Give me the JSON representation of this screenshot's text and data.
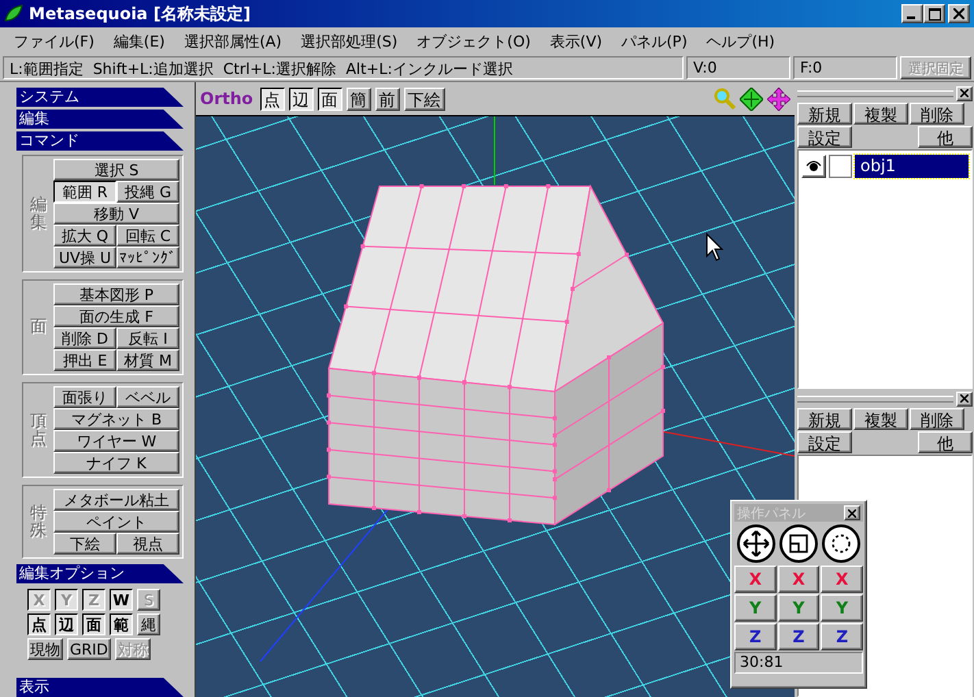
{
  "window": {
    "title": "Metasequoia [名称未設定]"
  },
  "menu": [
    "ファイル(F)",
    "編集(E)",
    "選択部属性(A)",
    "選択部処理(S)",
    "オブジェクト(O)",
    "表示(V)",
    "パネル(P)",
    "ヘルプ(H)"
  ],
  "hint_bar": {
    "hint": "L:範囲指定  Shift+L:追加選択  Ctrl+L:選択解除  Alt+L:インクルード選択",
    "vertices": "V:0",
    "faces": "F:0",
    "lock_button": {
      "label": "選択固定",
      "disabled": true
    }
  },
  "left_panel": {
    "top_headers": [
      "システム",
      "編集"
    ],
    "command_header": "コマンド",
    "command_groups": [
      {
        "label": "編集",
        "rows": [
          [
            {
              "label": "選択 S",
              "selected": false
            }
          ],
          [
            {
              "label": "範囲 R",
              "selected": true
            },
            {
              "label": "投縄 G",
              "selected": false
            }
          ],
          [
            {
              "label": "移動 V",
              "selected": false
            }
          ],
          [
            {
              "label": "拡大 Q",
              "selected": false
            },
            {
              "label": "回転 C",
              "selected": false
            }
          ],
          [
            {
              "label": "UV操 U",
              "selected": false
            },
            {
              "label": "ﾏｯﾋﾟﾝｸﾞ",
              "selected": false
            }
          ]
        ]
      },
      {
        "label": "面",
        "rows": [
          [
            {
              "label": "基本図形 P",
              "selected": false
            }
          ],
          [
            {
              "label": "面の生成 F",
              "selected": false
            }
          ],
          [
            {
              "label": "削除 D",
              "selected": false
            },
            {
              "label": "反転 I",
              "selected": false
            }
          ],
          [
            {
              "label": "押出 E",
              "selected": false
            },
            {
              "label": "材質 M",
              "selected": false
            }
          ]
        ]
      },
      {
        "label": "頂点",
        "rows": [
          [
            {
              "label": "面張り",
              "selected": false
            },
            {
              "label": "ベベル",
              "selected": false
            }
          ],
          [
            {
              "label": "マグネット B",
              "selected": false
            }
          ],
          [
            {
              "label": "ワイヤー W",
              "selected": false
            }
          ],
          [
            {
              "label": "ナイフ K",
              "selected": false
            }
          ]
        ]
      },
      {
        "label": "特殊",
        "rows": [
          [
            {
              "label": "メタボール粘土",
              "selected": false
            }
          ],
          [
            {
              "label": "ペイント",
              "selected": false
            }
          ],
          [
            {
              "label": "下絵",
              "selected": false
            },
            {
              "label": "視点",
              "selected": false
            }
          ]
        ]
      }
    ],
    "options_header": "編集オプション",
    "option_rows": [
      [
        {
          "label": "X",
          "pressed": true,
          "disabled": true
        },
        {
          "label": "Y",
          "pressed": true,
          "disabled": true
        },
        {
          "label": "Z",
          "pressed": true,
          "disabled": true
        },
        {
          "label": "W",
          "pressed": true,
          "disabled": false
        },
        {
          "label": "S",
          "pressed": false,
          "disabled": true
        }
      ],
      [
        {
          "label": "点",
          "pressed": true,
          "disabled": false
        },
        {
          "label": "辺",
          "pressed": true,
          "disabled": false
        },
        {
          "label": "面",
          "pressed": true,
          "disabled": false
        },
        {
          "label": "範",
          "pressed": true,
          "disabled": false
        },
        {
          "label": "縄",
          "pressed": false,
          "disabled": false
        }
      ],
      [
        {
          "label": "現物",
          "pressed": false,
          "disabled": false
        },
        {
          "label": "GRID",
          "pressed": false,
          "disabled": false
        },
        {
          "label": "対称",
          "pressed": false,
          "disabled": true
        }
      ]
    ],
    "bottom_header": "表示"
  },
  "viewport": {
    "mode": "Ortho",
    "buttons": [
      {
        "label": "点",
        "pressed": true
      },
      {
        "label": "辺",
        "pressed": true
      },
      {
        "label": "面",
        "pressed": true
      },
      {
        "label": "簡",
        "pressed": false
      },
      {
        "label": "前",
        "pressed": false
      },
      {
        "label": "下絵",
        "pressed": false
      }
    ]
  },
  "object_panel": {
    "buttons": [
      [
        "新規",
        "複製",
        "削除"
      ],
      [
        "設定",
        "他"
      ]
    ],
    "objects": [
      {
        "name": "obj1",
        "visible": true,
        "selected": true
      }
    ]
  },
  "material_panel": {
    "buttons": [
      [
        "新規",
        "複製",
        "削除"
      ],
      [
        "設定",
        "他"
      ]
    ]
  },
  "operation_panel": {
    "title": "操作パネル",
    "axes": [
      [
        {
          "label": "X",
          "color": "#e8103c"
        },
        {
          "label": "X",
          "color": "#e8103c"
        },
        {
          "label": "X",
          "color": "#e8103c"
        }
      ],
      [
        {
          "label": "Y",
          "color": "#108018"
        },
        {
          "label": "Y",
          "color": "#108018"
        },
        {
          "label": "Y",
          "color": "#108018"
        }
      ],
      [
        {
          "label": "Z",
          "color": "#2020c0"
        },
        {
          "label": "Z",
          "color": "#2020c0"
        },
        {
          "label": "Z",
          "color": "#2020c0"
        }
      ]
    ],
    "readout": "30:81"
  }
}
